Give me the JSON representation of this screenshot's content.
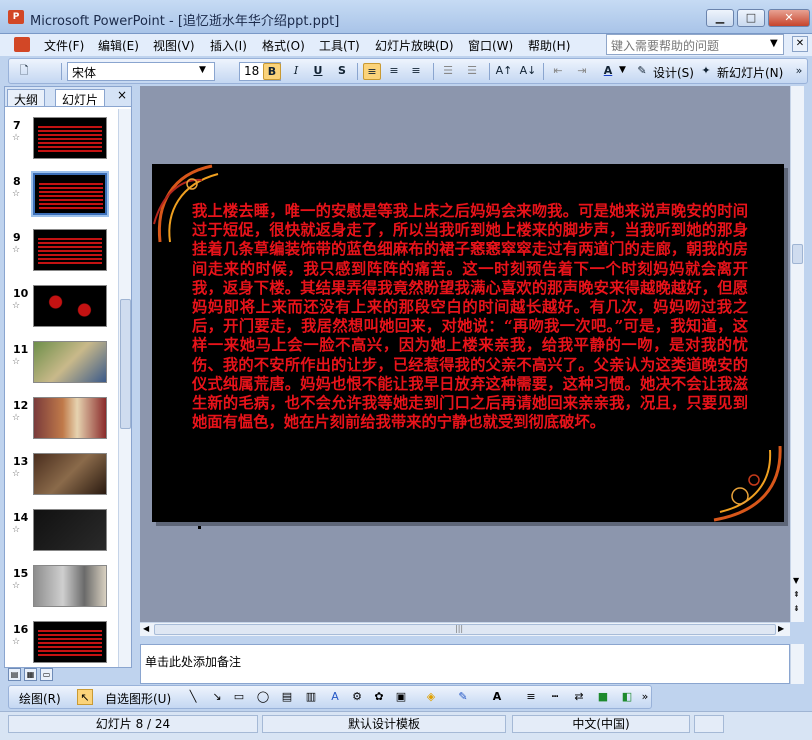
{
  "window": {
    "app_badge": "P",
    "title": "Microsoft PowerPoint - [追忆逝水年华介绍ppt.ppt]",
    "minimize": "▁",
    "maximize": "□",
    "close": "✕"
  },
  "menu": {
    "items": [
      "文件(F)",
      "编辑(E)",
      "视图(V)",
      "插入(I)",
      "格式(O)",
      "工具(T)",
      "幻灯片放映(D)",
      "窗口(W)",
      "帮助(H)"
    ],
    "help_placeholder": "键入需要帮助的问题"
  },
  "toolbar": {
    "font": "宋体",
    "size": "18",
    "bold": "B",
    "italic": "I",
    "underline": "U",
    "shadow": "S",
    "design_label": "设计(S)",
    "new_slide_label": "新幻灯片(N)"
  },
  "leftpane": {
    "tab_outline": "大纲",
    "tab_slides": "幻灯片",
    "close": "×",
    "slides": [
      {
        "num": "7",
        "kind": "text"
      },
      {
        "num": "8",
        "kind": "text",
        "selected": true
      },
      {
        "num": "9",
        "kind": "text"
      },
      {
        "num": "10",
        "kind": "diagram"
      },
      {
        "num": "11",
        "kind": "photo"
      },
      {
        "num": "12",
        "kind": "photo"
      },
      {
        "num": "13",
        "kind": "photo"
      },
      {
        "num": "14",
        "kind": "photo"
      },
      {
        "num": "15",
        "kind": "photo"
      },
      {
        "num": "16",
        "kind": "text"
      }
    ]
  },
  "slide": {
    "body": "我上楼去睡，唯一的安慰是等我上床之后妈妈会来吻我。可是她来说声晚安的时间过于短促，很快就返身走了，所以当我听到她上楼来的脚步声，当我听到她的那身挂着几条草编装饰带的蓝色细麻布的裙子窸窸窣窣走过有两道门的走廊，朝我的房间走来的时候，我只感到阵阵的痛苦。这一时刻预告着下一个时刻妈妈就会离开我，返身下楼。其结果弄得我竟然盼望我满心喜欢的那声晚安来得越晚越好，但愿妈妈即将上来而还没有上来的那段空白的时间越长越好。有几次，妈妈吻过我之后，开门要走，我居然想叫她回来，对她说：“再吻我一次吧。”可是，我知道，这样一来她马上会一脸不高兴，因为她上楼来亲我，给我平静的一吻，是对我的忧伤、我的不安所作出的让步，已经惹得我的父亲不高兴了。父亲认为这类道晚安的仪式纯属荒唐。妈妈也恨不能让我早日放弃这种需要，这种习惯。她决不会让我滋生新的毛病，也不会允许我等她走到门口之后再请她回来亲亲我，况且，只要见到她面有愠色，她在片刻前给我带来的宁静也就受到彻底破坏。"
  },
  "notes": {
    "placeholder": "单击此处添加备注"
  },
  "drawbar": {
    "draw_label": "绘图(R)",
    "autoshapes_label": "自选图形(U)"
  },
  "status": {
    "slide_info": "幻灯片 8 / 24",
    "template": "默认设计模板",
    "language": "中文(中国)"
  }
}
